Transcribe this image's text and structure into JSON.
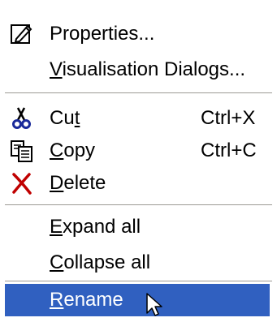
{
  "menu": {
    "items": [
      {
        "label": "Properties...",
        "accel_index": -1,
        "shortcut": "",
        "icon": "properties-icon"
      },
      {
        "label": "Visualisation Dialogs...",
        "accel_index": 0,
        "shortcut": "",
        "icon": ""
      },
      {
        "label": "Cut",
        "accel_index": 2,
        "shortcut": "Ctrl+X",
        "icon": "scissors-icon"
      },
      {
        "label": "Copy",
        "accel_index": 0,
        "shortcut": "Ctrl+C",
        "icon": "copy-icon"
      },
      {
        "label": "Delete",
        "accel_index": 0,
        "shortcut": "",
        "icon": "delete-icon"
      },
      {
        "label": "Expand all",
        "accel_index": 0,
        "shortcut": "",
        "icon": ""
      },
      {
        "label": "Collapse all",
        "accel_index": 0,
        "shortcut": "",
        "icon": ""
      },
      {
        "label": "Rename",
        "accel_index": 0,
        "shortcut": "",
        "icon": "",
        "selected": true
      }
    ]
  },
  "colors": {
    "selection_bg": "#3060c0",
    "selection_text": "#ffffff",
    "separator": "#9c9a94",
    "delete_icon": "#c00000"
  }
}
